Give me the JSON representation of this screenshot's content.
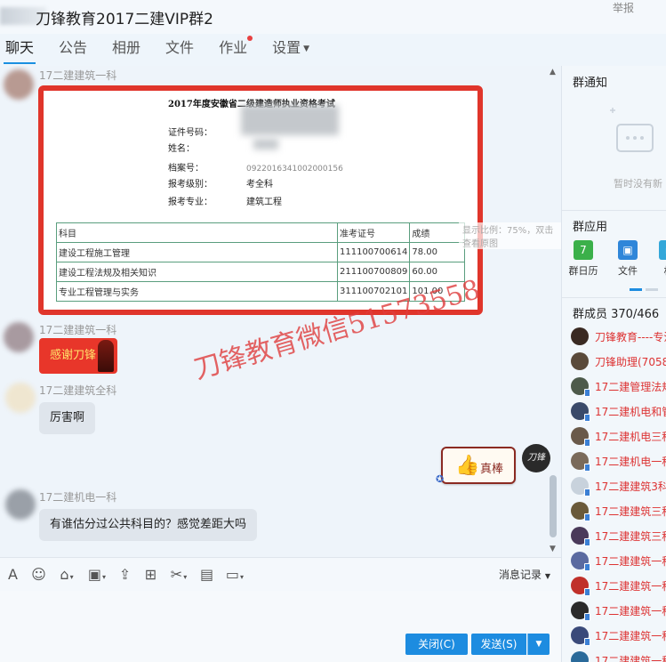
{
  "window": {
    "title": "刀锋教育2017二建VIP群2",
    "report_label": "举报"
  },
  "tabs": [
    {
      "label": "聊天",
      "active": true
    },
    {
      "label": "公告"
    },
    {
      "label": "相册"
    },
    {
      "label": "文件"
    },
    {
      "label": "作业",
      "badge_dot": true
    },
    {
      "label": "设置",
      "has_dropdown": true
    }
  ],
  "messages": [
    {
      "sender": "17二建建筑一科",
      "type": "image"
    },
    {
      "sender": "17二建建筑一科",
      "type": "sticker",
      "text": "感谢刀锋"
    },
    {
      "sender": "17二建建筑全科",
      "text": "厉害啊"
    },
    {
      "sender": "self",
      "type": "sticker",
      "text": "真棒"
    },
    {
      "sender": "17二建机电一科",
      "text": "有谁估分过公共科目的？感觉差距大吗"
    }
  ],
  "certificate": {
    "title": "2017年度安徽省二级建造师执业资格考试",
    "fields": [
      {
        "label": "证件号码：",
        "value": ""
      },
      {
        "label": "姓名：",
        "value": ""
      },
      {
        "label": "档案号：",
        "value": "0922016341002000156"
      },
      {
        "label": "报考级别：",
        "value": "考全科"
      },
      {
        "label": "报考专业：",
        "value": "建筑工程"
      }
    ],
    "table": {
      "headers": [
        "科目",
        "准考证号",
        "成绩"
      ],
      "rows": [
        [
          "建设工程施工管理",
          "111100700614",
          "78.00"
        ],
        [
          "建设工程法规及相关知识",
          "211100700809",
          "60.00"
        ],
        [
          "专业工程管理与实务",
          "311100702101",
          "101.00"
        ]
      ]
    },
    "zoom_hint": "显示比例：75%，双击查看原图",
    "watermark": "刀锋教育微信51573558"
  },
  "self_avatar_text": "刀锋",
  "toolbar": {
    "icons": [
      "font-icon",
      "emoji-icon",
      "gift-icon",
      "image-icon",
      "upload-icon",
      "shop-icon",
      "scissors-icon",
      "box-icon",
      "chat-plus-icon"
    ],
    "history_label": "消息记录"
  },
  "buttons": {
    "close": "关闭(C)",
    "send": "发送(S)"
  },
  "right_panel": {
    "notice_title": "群通知",
    "notice_empty": "暂时没有新",
    "apps_title": "群应用",
    "apps": [
      {
        "label": "群日历",
        "icon": "calendar-icon",
        "color": "#3bb04a",
        "glyph": "7"
      },
      {
        "label": "文件",
        "icon": "folder-icon",
        "color": "#2f86d9",
        "glyph": "▣"
      },
      {
        "label": "相",
        "icon": "photo-icon",
        "color": "#34a7d9",
        "glyph": "▪"
      }
    ],
    "members_title": "群成员 370/466",
    "members": [
      {
        "name": "刀锋教育----专注",
        "color": "#3a2a22"
      },
      {
        "name": "刀锋助理(70583",
        "color": "#5a4a3a"
      },
      {
        "name": "17二建管理法规",
        "color": "#4d5a4a"
      },
      {
        "name": "17二建机电和管",
        "color": "#3a4a6a"
      },
      {
        "name": "17二建机电三科",
        "color": "#6a5a4a"
      },
      {
        "name": "17二建机电一科",
        "color": "#7a6a5a"
      },
      {
        "name": "17二建建筑3科",
        "color": "#c8d2dc"
      },
      {
        "name": "17二建建筑三科",
        "color": "#6a5a3a"
      },
      {
        "name": "17二建建筑三科",
        "color": "#4a3a5a"
      },
      {
        "name": "17二建建筑一科",
        "color": "#5a6aa0"
      },
      {
        "name": "17二建建筑一科",
        "color": "#c0302a"
      },
      {
        "name": "17二建建筑一科",
        "color": "#2a2a2a"
      },
      {
        "name": "17二建建筑一科",
        "color": "#3a4a7a"
      },
      {
        "name": "17二建建筑一科",
        "color": "#2a6a9a"
      }
    ]
  }
}
